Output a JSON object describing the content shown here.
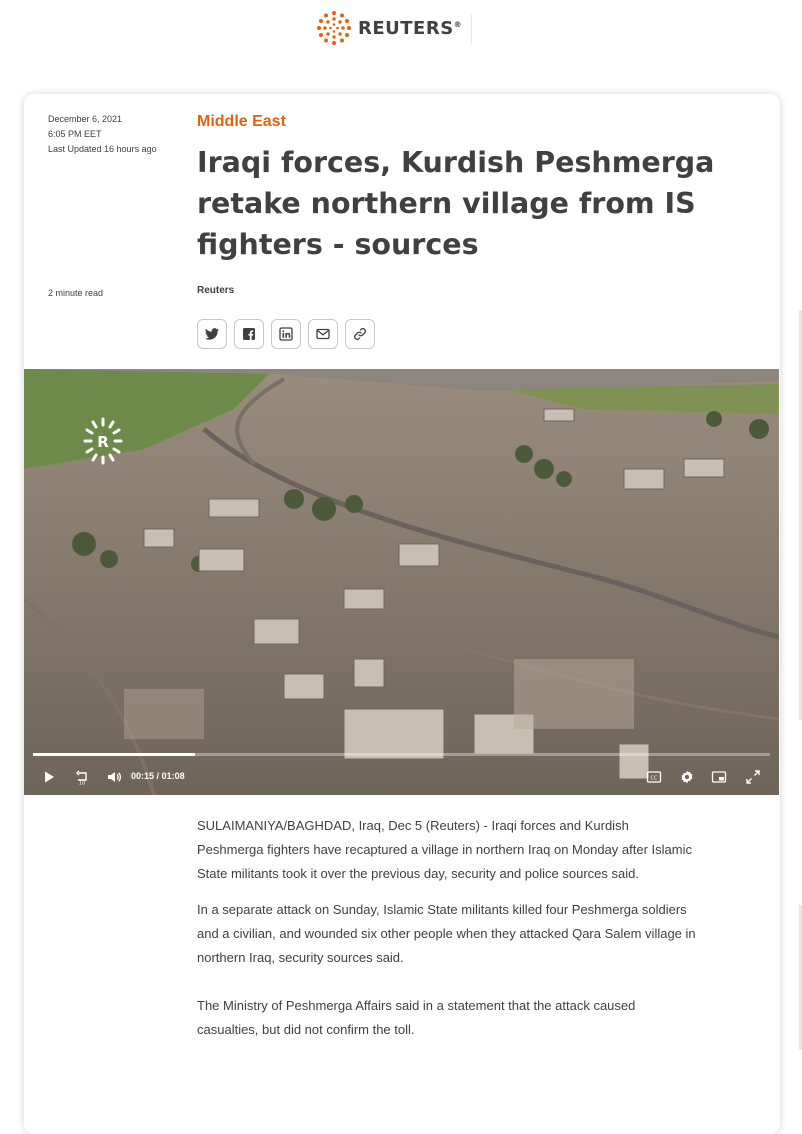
{
  "brand": {
    "name": "REUTERS",
    "reg": "®"
  },
  "article": {
    "date": "December 6, 2021",
    "time": "6:05 PM EET",
    "updated": "Last Updated 16 hours ago",
    "read_time": "2 minute read",
    "section": "Middle East",
    "headline": "Iraqi forces, Kurdish Peshmerga retake northern village from IS fighters - sources",
    "byline": "Reuters"
  },
  "share": {
    "icons": [
      "twitter-icon",
      "facebook-icon",
      "linkedin-icon",
      "email-icon",
      "link-icon"
    ]
  },
  "video": {
    "current": "00:15",
    "separator": "/",
    "duration": "01:08",
    "progress": 0.22,
    "watermark_letter": "R"
  },
  "body": {
    "paragraphs": [
      "SULAIMANIYA/BAGHDAD, Iraq, Dec 5 (Reuters) - Iraqi forces and Kurdish Peshmerga fighters have recaptured a village in northern Iraq on Monday after Islamic State militants took it over the previous day, security and police sources said.",
      "In a separate attack on Sunday, Islamic State militants killed four Peshmerga soldiers and a civilian, and wounded six other people when they attacked Qara Salem village in northern Iraq, security sources said.",
      "The Ministry of Peshmerga Affairs said in a statement that the attack caused casualties, but did not confirm the toll."
    ]
  },
  "colors": {
    "accent": "#e2620e",
    "text": "#404040"
  }
}
